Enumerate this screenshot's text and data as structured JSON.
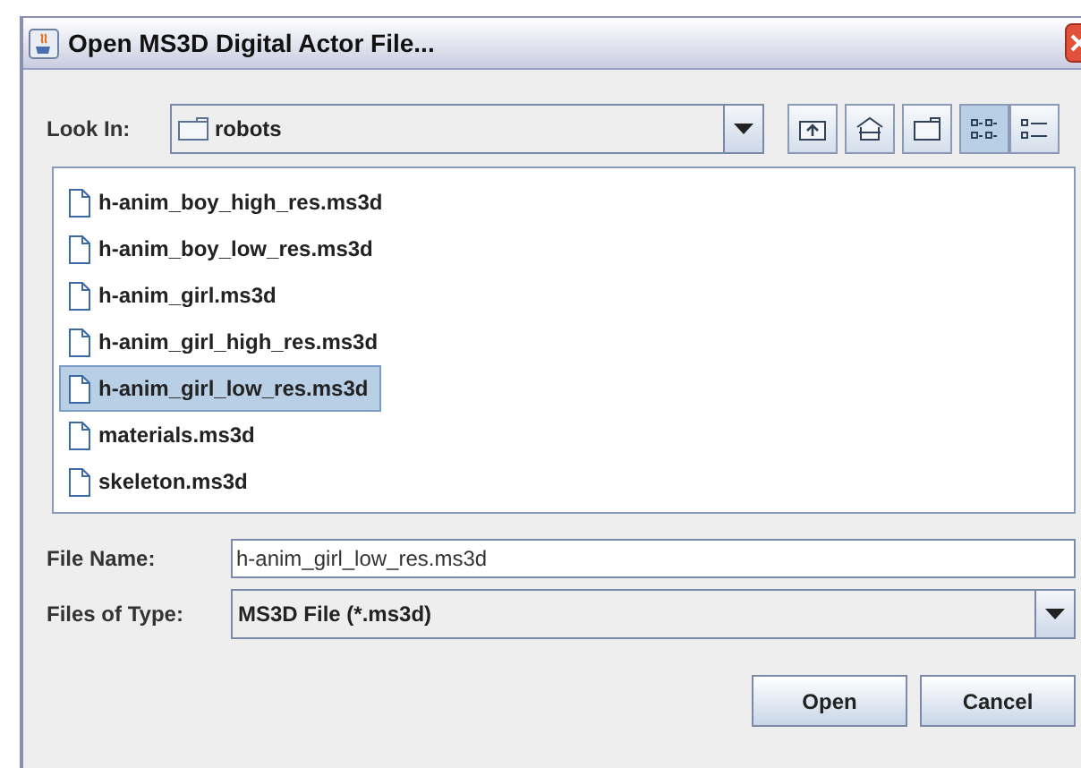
{
  "window": {
    "title": "Open MS3D Digital Actor File..."
  },
  "look_in": {
    "label": "Look In:",
    "value": "robots"
  },
  "toolbar": [
    {
      "kind": "up-folder",
      "selected": false
    },
    {
      "kind": "home",
      "selected": false
    },
    {
      "kind": "new-folder",
      "selected": false
    },
    {
      "kind": "list-view",
      "selected": true
    },
    {
      "kind": "details-view",
      "selected": false
    }
  ],
  "files": [
    {
      "name": "h-anim_boy_high_res.ms3d",
      "selected": false
    },
    {
      "name": "h-anim_boy_low_res.ms3d",
      "selected": false
    },
    {
      "name": "h-anim_girl.ms3d",
      "selected": false
    },
    {
      "name": "h-anim_girl_high_res.ms3d",
      "selected": false
    },
    {
      "name": "h-anim_girl_low_res.ms3d",
      "selected": true
    },
    {
      "name": "materials.ms3d",
      "selected": false
    },
    {
      "name": "skeleton.ms3d",
      "selected": false
    }
  ],
  "file_name": {
    "label": "File Name:",
    "value": "h-anim_girl_low_res.ms3d"
  },
  "file_type": {
    "label": "Files of Type:",
    "value": "MS3D File (*.ms3d)"
  },
  "buttons": [
    "Open",
    "Cancel"
  ]
}
